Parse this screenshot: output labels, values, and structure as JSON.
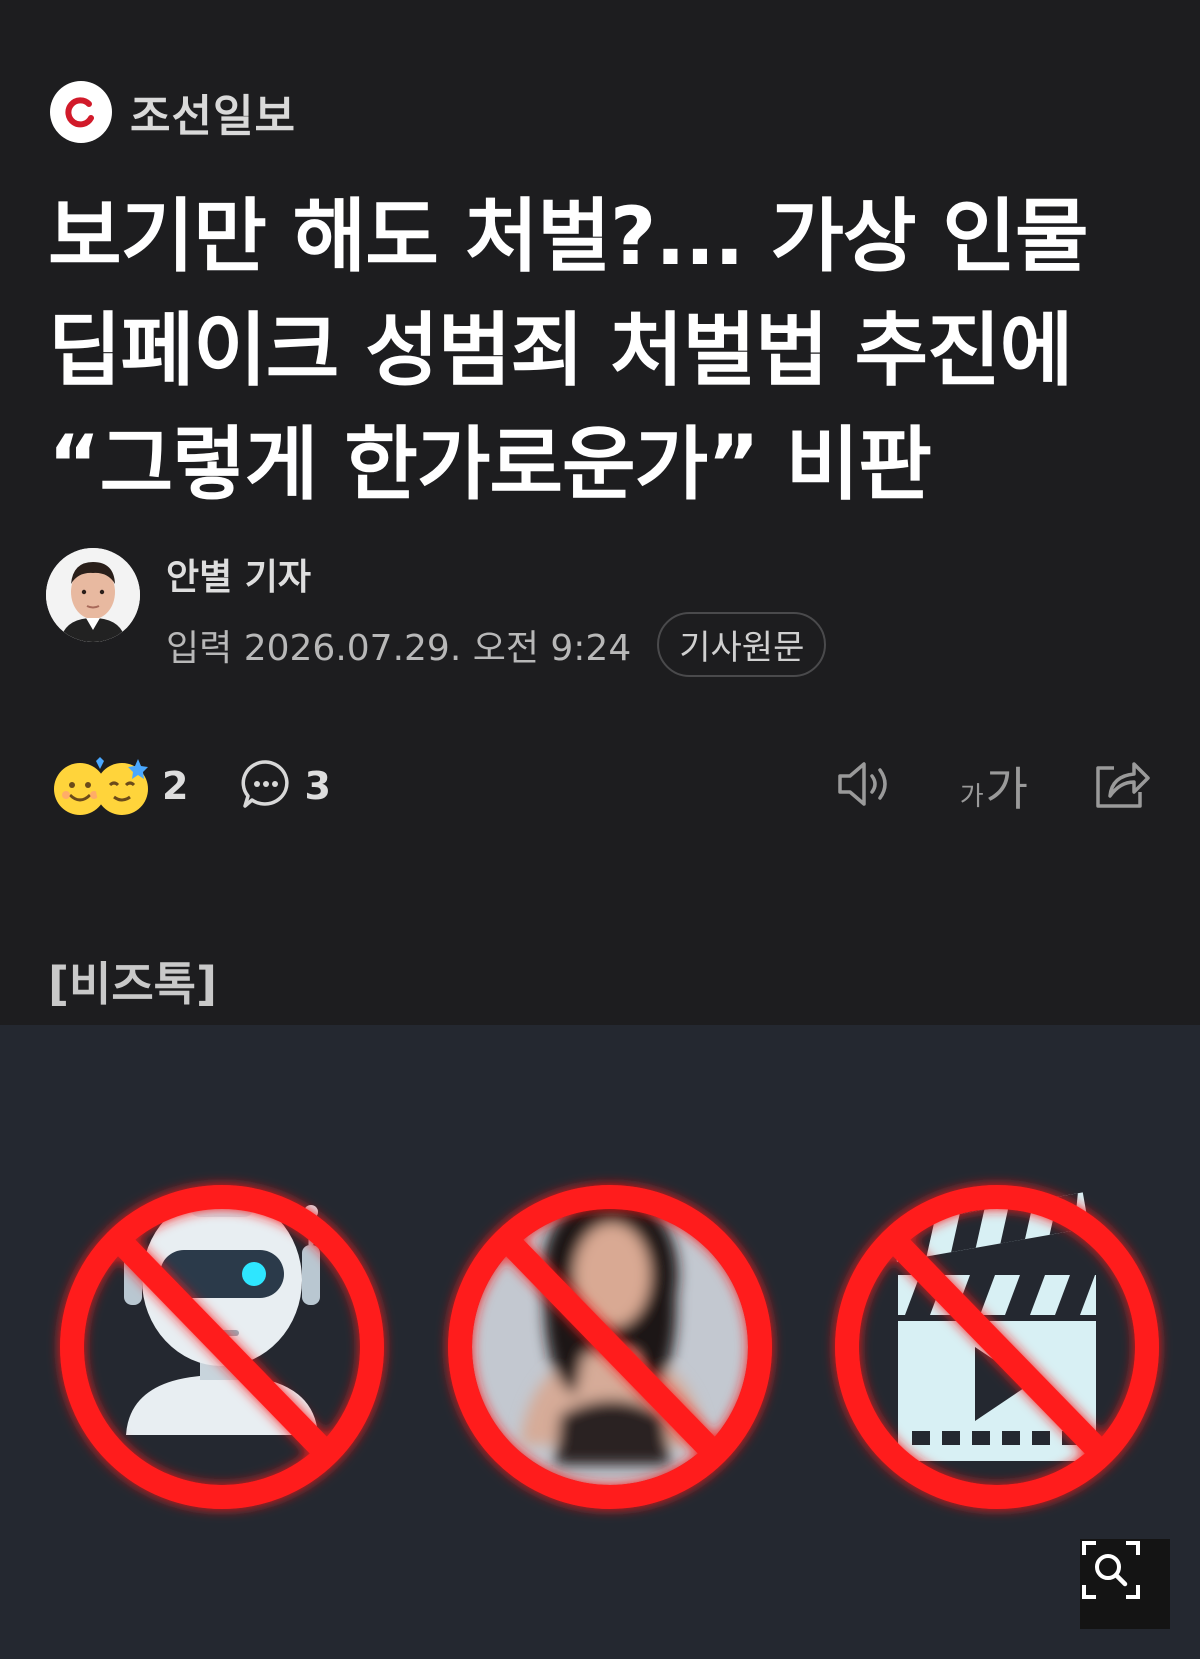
{
  "publisher": {
    "name": "조선일보",
    "logo_icon": "chosun-logo-icon"
  },
  "headline": "보기만 해도 처벌?... 가상 인물 딥페이크 성범죄 처벌법 추진에 “그렇게 한가로운가” 비판",
  "byline": {
    "author": "안별 기자",
    "date_label": "입력",
    "date": "2026.07.29. 오전 9:24",
    "original_button": "기사원문"
  },
  "actions": {
    "reaction_count": "2",
    "comment_count": "3",
    "reaction_icon": "emoji-reaction-icon",
    "comment_icon": "comment-icon",
    "tts_icon": "speaker-icon",
    "font_size_small": "가",
    "font_size_large": "가",
    "share_icon": "share-icon"
  },
  "section_tag": "[비즈톡]",
  "image": {
    "description_icons": [
      "robot-icon",
      "blurred-person-icon",
      "film-clapper-icon"
    ],
    "prohibition_color": "#ff1f1f",
    "zoom_icon": "zoom-icon"
  },
  "colors": {
    "background": "#1d1d1f",
    "image_bg": "#242830",
    "accent": "#c8102e"
  }
}
